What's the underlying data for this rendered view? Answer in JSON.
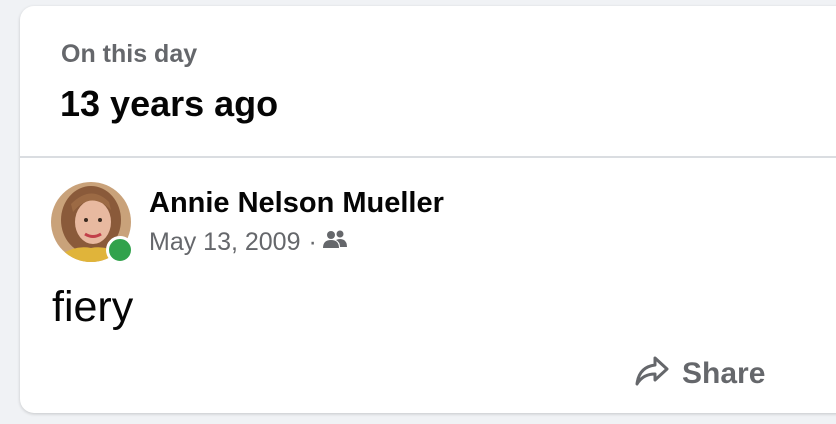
{
  "memory": {
    "eyebrow": "On this day",
    "headline": "13 years ago"
  },
  "post": {
    "author": "Annie Nelson Mueller",
    "date": "May 13, 2009",
    "separator": "·",
    "audience_icon": "friends-icon",
    "text": "fiery",
    "online_status_color": "#31a24c"
  },
  "actions": {
    "share_label": "Share",
    "share_icon": "share-arrow-icon"
  }
}
